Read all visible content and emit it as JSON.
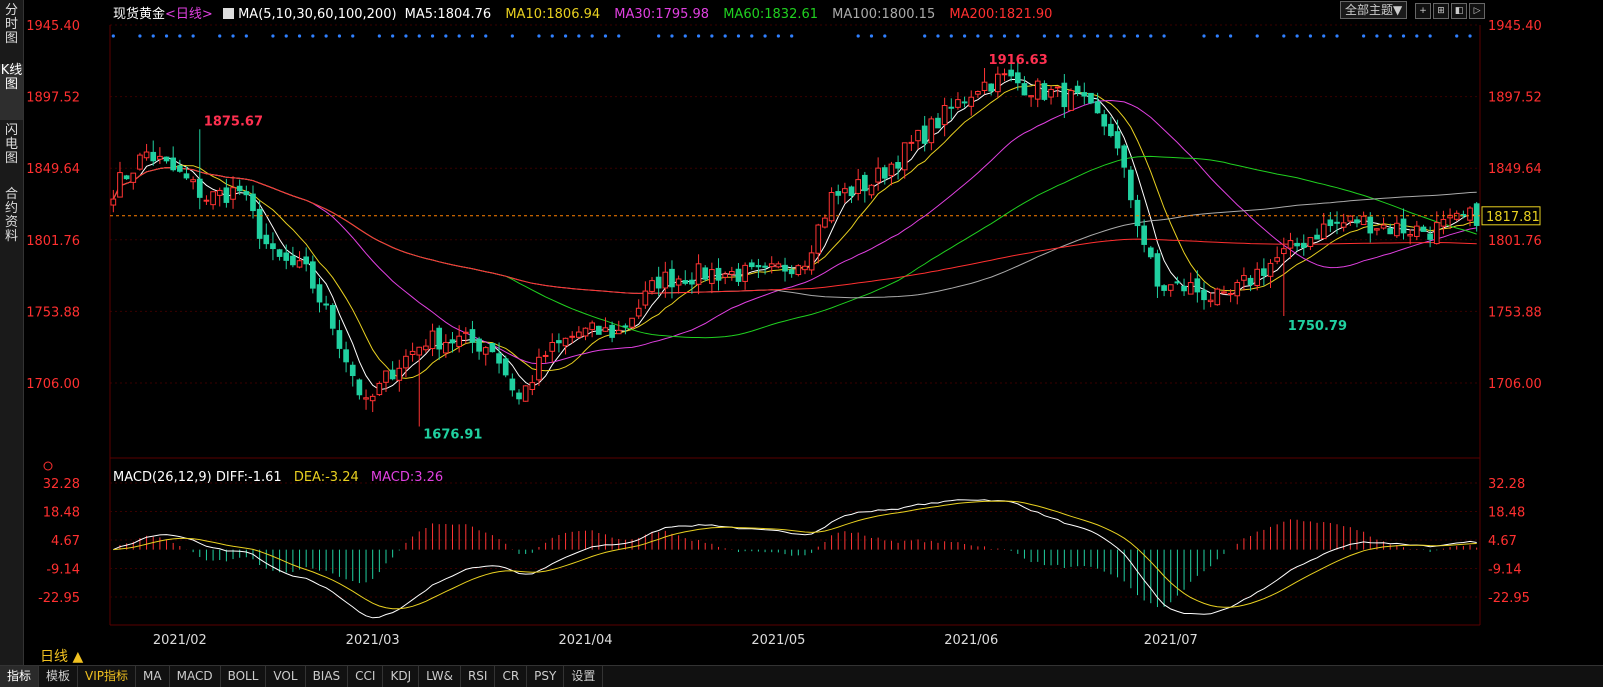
{
  "sidebar": {
    "tabs": [
      {
        "label": "分时图",
        "active": false
      },
      {
        "label": "K线图",
        "active": true
      },
      {
        "label": "闪电图",
        "active": false
      },
      {
        "label": "合约资料",
        "active": false
      }
    ]
  },
  "header": {
    "instrument": "现货黄金",
    "period": "<日线>",
    "ma_params": "MA(5,10,30,60,100,200)",
    "ma_values": [
      {
        "text": "MA5:1804.76",
        "color": "#ffffff"
      },
      {
        "text": "MA10:1806.94",
        "color": "#e8d020"
      },
      {
        "text": "MA30:1795.98",
        "color": "#e040e0"
      },
      {
        "text": "MA60:1832.61",
        "color": "#20d020"
      },
      {
        "text": "MA100:1800.15",
        "color": "#aaaaaa"
      },
      {
        "text": "MA200:1821.90",
        "color": "#ff3030"
      }
    ]
  },
  "toolbar": {
    "theme_label": "全部主题▼"
  },
  "macd_header": {
    "params": "MACD(26,12,9)",
    "diff": "DIFF:-1.61",
    "dea": "DEA:-3.24",
    "macd": "MACD:3.26"
  },
  "price_axis": {
    "ticks": [
      "1945.40",
      "1897.52",
      "1849.64",
      "1801.76",
      "1753.88",
      "1706.00"
    ]
  },
  "macd_axis": {
    "ticks": [
      "32.28",
      "18.48",
      "4.67",
      "-9.14",
      "-22.95"
    ]
  },
  "date_axis": {
    "labels": [
      "2021/02",
      "2021/03",
      "2021/04",
      "2021/05",
      "2021/06",
      "2021/07"
    ]
  },
  "annotations": {
    "high_label": "1875.67",
    "low_label": "1676.91",
    "peak_label": "1916.63",
    "trough_label": "1750.79",
    "current_price": "1817.81"
  },
  "bottom_bar": {
    "period_button": "日线 ▲",
    "tabs": [
      "指标",
      "模板",
      "VIP指标",
      "MA",
      "MACD",
      "BOLL",
      "VOL",
      "BIAS",
      "CCI",
      "KDJ",
      "LW&",
      "RSI",
      "CR",
      "PSY",
      "设置"
    ]
  },
  "colors": {
    "up": "#ff3333",
    "down": "#20d0a0",
    "grid": "#5a0000"
  },
  "chart_data": {
    "type": "candlestick",
    "price_range": [
      1676.91,
      1945.4
    ],
    "macd_range": [
      -27,
      34
    ],
    "date_ticks_index": {
      "2021/02": 10,
      "2021/03": 39,
      "2021/04": 71,
      "2021/05": 100,
      "2021/06": 129,
      "2021/07": 159
    },
    "candles": []
  }
}
